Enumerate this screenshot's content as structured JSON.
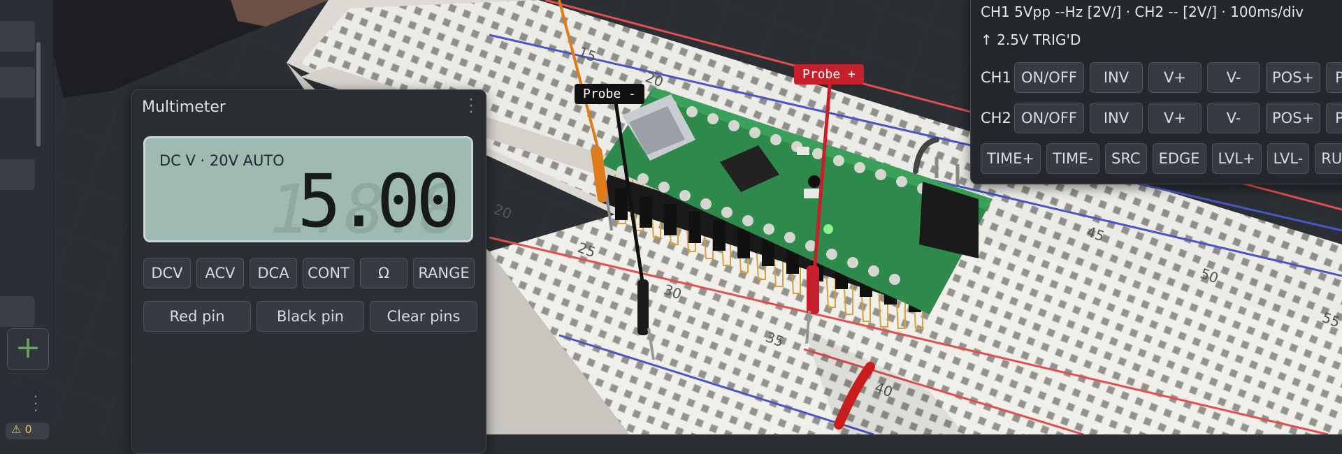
{
  "probes": {
    "negative_label": "Probe -",
    "positive_label": "Probe +"
  },
  "multimeter": {
    "title": "Multimeter",
    "mode_text": "DC V · 20V AUTO",
    "ghost_digits": "1.8.8",
    "reading": "5.00",
    "mode_buttons": [
      "DCV",
      "ACV",
      "DCA",
      "CONT",
      "Ω",
      "RANGE"
    ],
    "pin_buttons": [
      "Red pin",
      "Black pin",
      "Clear pins"
    ]
  },
  "oscilloscope": {
    "status_line": "CH1 5Vpp --Hz [2V/]  ·  CH2 -- [2V/]  ·  100ms/div",
    "trigger_line": "↑ 2.5V TRIG'D",
    "ch1_label": "CH1",
    "ch2_label": "CH2",
    "channel_buttons": [
      "ON/OFF",
      "INV",
      "V+",
      "V-",
      "POS+",
      "POS-"
    ],
    "time_buttons": [
      "TIME+",
      "TIME-",
      "SRC",
      "EDGE",
      "LVL+",
      "LVL-",
      "RUN/STOP"
    ]
  },
  "breadboard": {
    "row_numbers": [
      "15",
      "20",
      "25",
      "30",
      "35",
      "40",
      "45",
      "50",
      "55",
      "20"
    ],
    "colors": {
      "board": "#ecebe6",
      "rail_red": "#e05050",
      "rail_blue": "#4a56c8",
      "pcb": "#2e8a4a",
      "pin_gold": "#d8a23a",
      "probe_red": "#c8202a",
      "probe_black": "#111111",
      "wire_orange": "#e07a1a"
    }
  },
  "sidebar": {
    "add_icon": "plus-icon",
    "warning_icon": "warning-icon",
    "warning_count": "0"
  }
}
